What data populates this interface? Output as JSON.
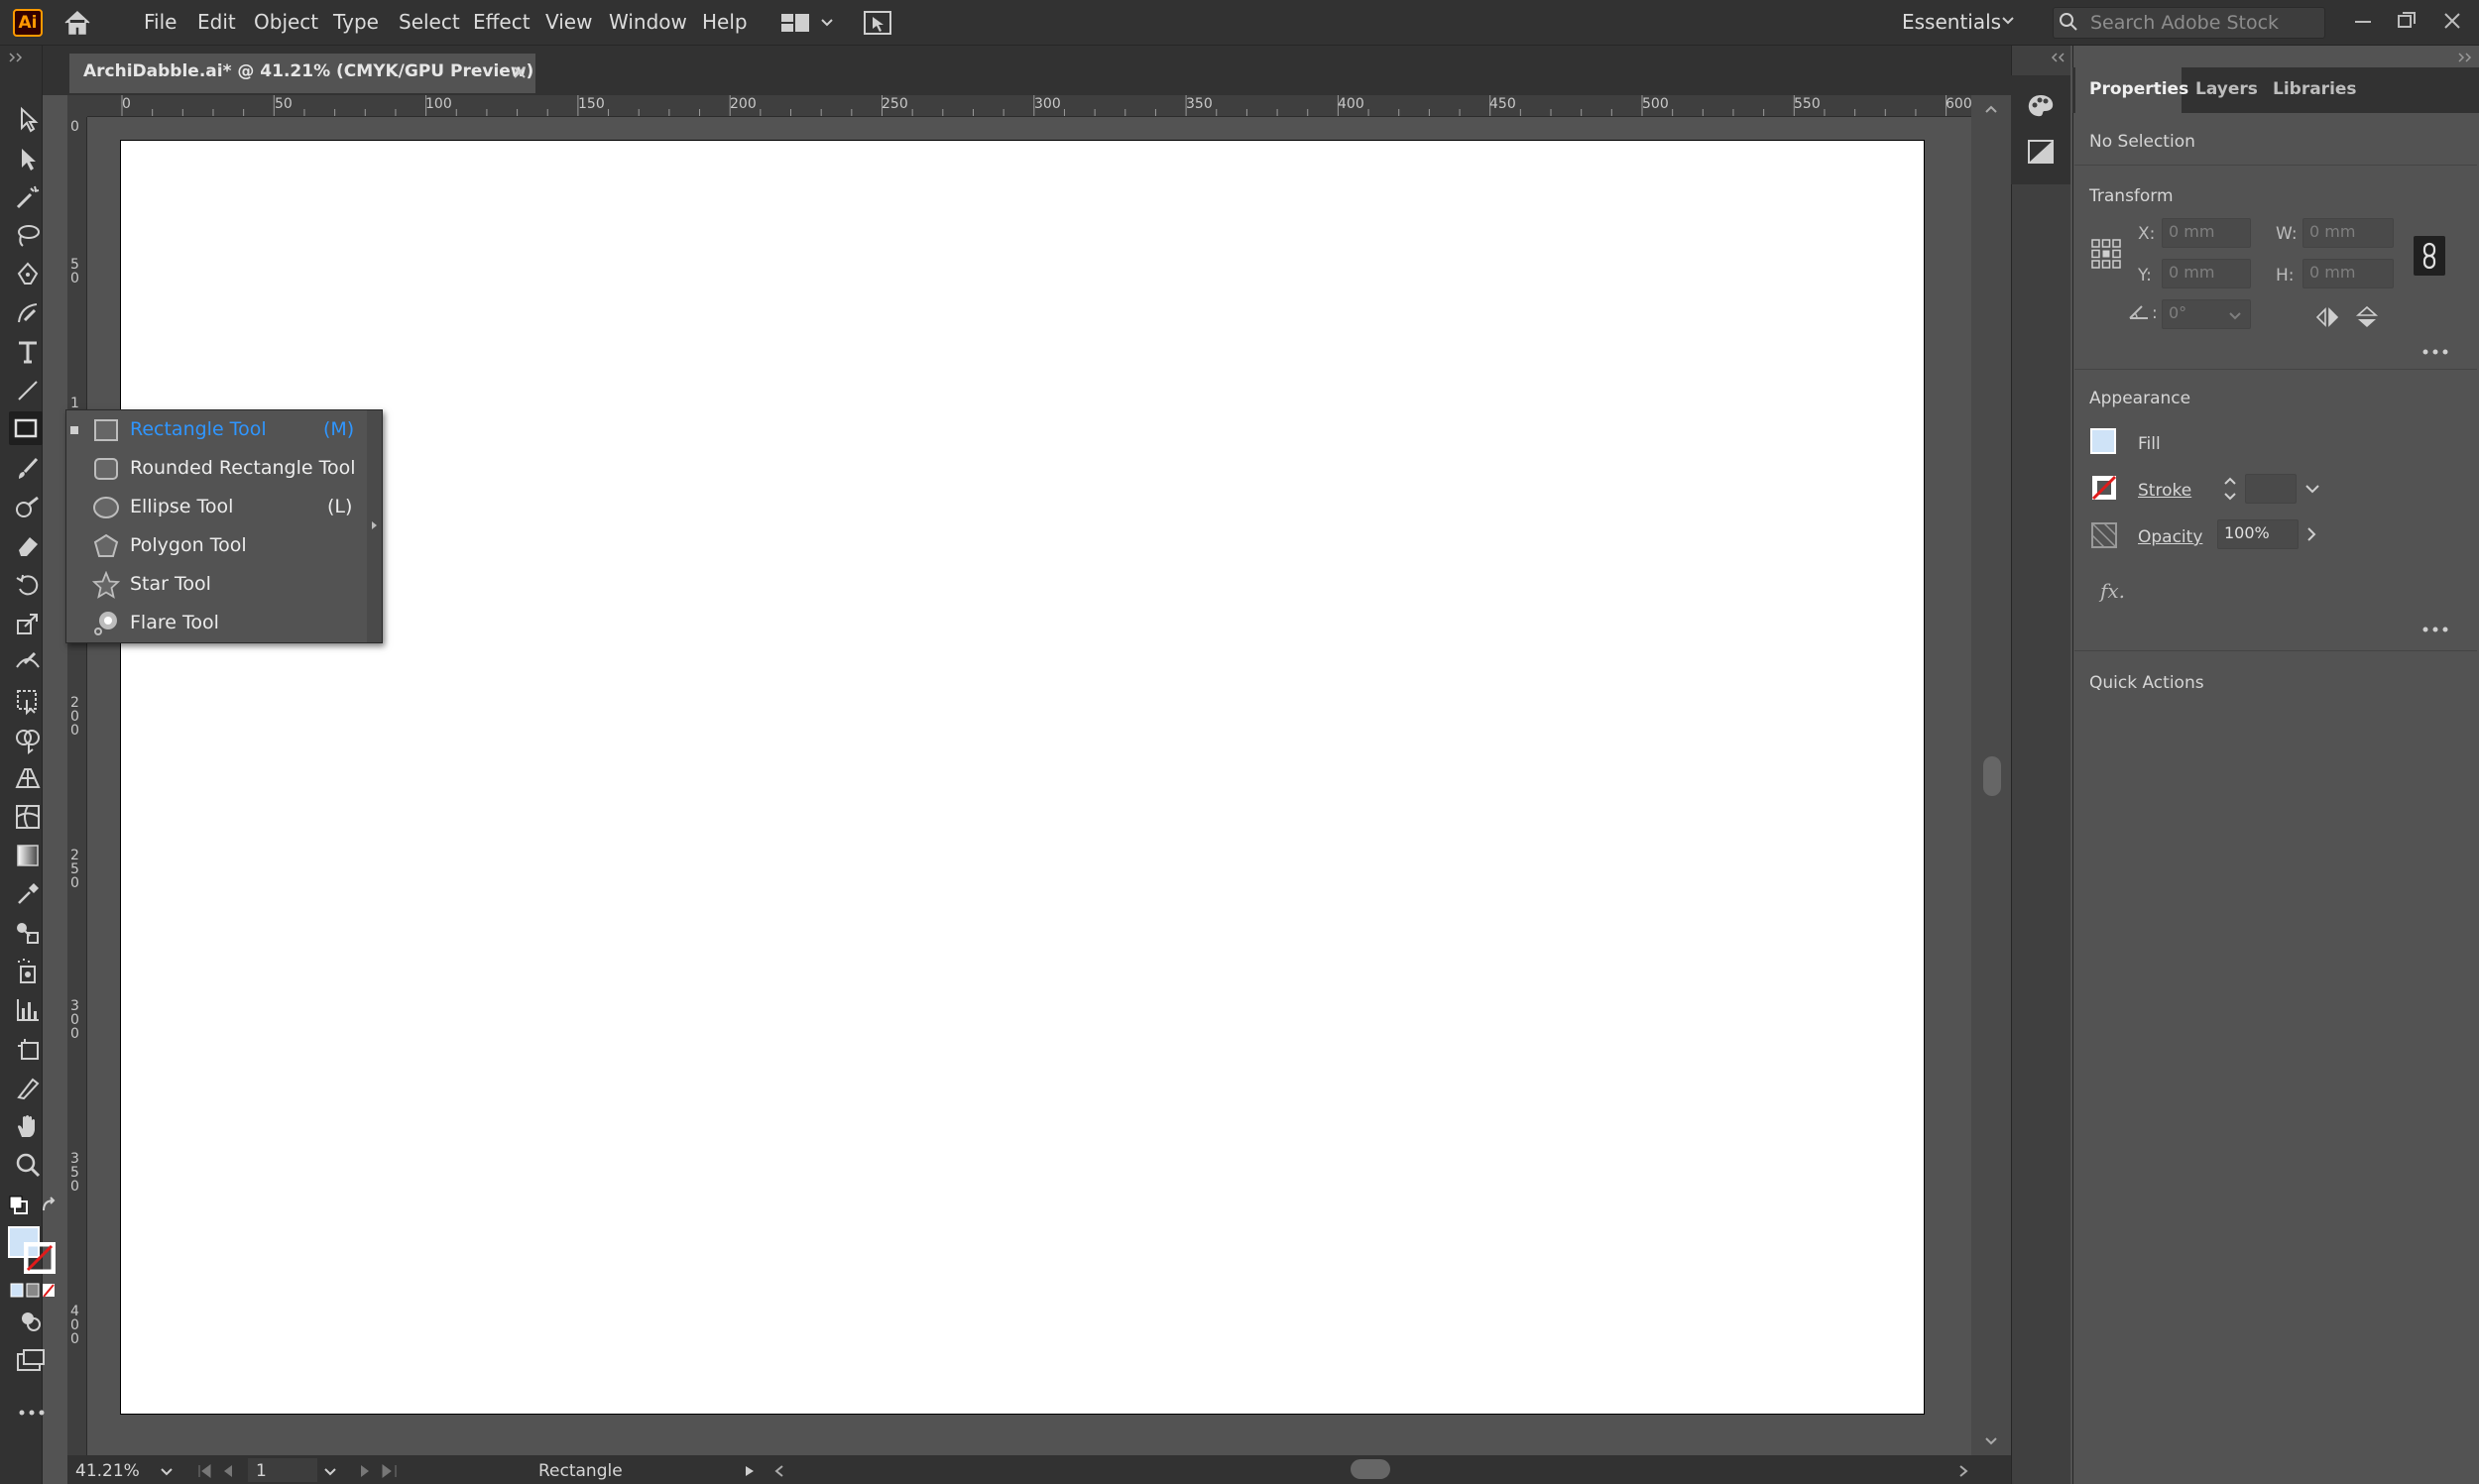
{
  "app": {
    "logo_text": "Ai",
    "menu": [
      "File",
      "Edit",
      "Object",
      "Type",
      "Select",
      "Effect",
      "View",
      "Window",
      "Help"
    ],
    "workspace": "Essentials",
    "search_placeholder": "Search Adobe Stock"
  },
  "document": {
    "tab_title": "ArchiDabble.ai* @ 41.21% (CMYK/GPU Preview)"
  },
  "rulers": {
    "top": [
      "0",
      "50",
      "100",
      "150",
      "200",
      "250",
      "300",
      "350",
      "400",
      "450",
      "500",
      "550",
      "600"
    ],
    "left": [
      "0",
      "5 0",
      "1",
      "2 0 0",
      "2 5 0",
      "3 0 0",
      "3 5 0",
      "4 0 0"
    ]
  },
  "flyout": {
    "items": [
      {
        "label": "Rectangle Tool",
        "shortcut": "(M)",
        "icon": "rectangle-icon",
        "active": true
      },
      {
        "label": "Rounded Rectangle Tool",
        "shortcut": "",
        "icon": "rounded-rectangle-icon",
        "active": false
      },
      {
        "label": "Ellipse Tool",
        "shortcut": "(L)",
        "icon": "ellipse-icon",
        "active": false
      },
      {
        "label": "Polygon Tool",
        "shortcut": "",
        "icon": "polygon-icon",
        "active": false
      },
      {
        "label": "Star Tool",
        "shortcut": "",
        "icon": "star-icon",
        "active": false
      },
      {
        "label": "Flare Tool",
        "shortcut": "",
        "icon": "flare-icon",
        "active": false
      }
    ]
  },
  "status": {
    "zoom": "41.21%",
    "artboard": "1",
    "current_tool": "Rectangle"
  },
  "panel": {
    "tabs": [
      "Properties",
      "Layers",
      "Libraries"
    ],
    "selection": "No Selection",
    "transform": {
      "title": "Transform",
      "x_label": "X:",
      "x_value": "0 mm",
      "y_label": "Y:",
      "y_value": "0 mm",
      "w_label": "W:",
      "w_value": "0 mm",
      "h_label": "H:",
      "h_value": "0 mm",
      "angle_value": "0°"
    },
    "appearance": {
      "title": "Appearance",
      "fill_label": "Fill",
      "stroke_label": "Stroke",
      "opacity_label": "Opacity",
      "opacity_value": "100%",
      "fx_label": "fx."
    },
    "quick_actions": "Quick Actions"
  },
  "colors": {
    "accent": "#2f96ff",
    "fill_swatch": "#cfe3f7",
    "stroke_none": "#e01b1b",
    "logo": "#ff9a00"
  }
}
